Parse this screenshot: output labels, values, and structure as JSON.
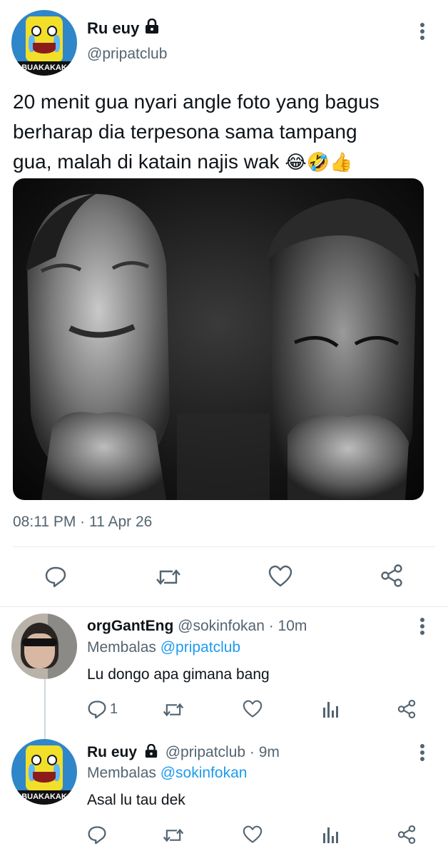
{
  "tweet": {
    "display_name": "Ru euy",
    "handle": "@pripatclub",
    "avatar_text": "BUAKAKAK",
    "text_line1": "20 menit gua nyari angle foto yang bagus",
    "text_line2": "berharap dia terpesona sama tampang",
    "text_line3": "gua, malah di katain najis wak",
    "emoji": "😂🤣👍",
    "timestamp": "08:11 PM · 11 Apr 26"
  },
  "replies": [
    {
      "display_name": "orgGantEng",
      "meta": "@sokinfokan · 10m",
      "replying_prefix": "Membalas",
      "replying_to": "@pripatclub",
      "text": "Lu dongo apa gimana bang",
      "reply_count": "1"
    },
    {
      "display_name": "Ru euy",
      "meta": "@pripatclub · 9m",
      "avatar_text": "BUAKAKAK",
      "replying_prefix": "Membalas",
      "replying_to": "@sokinfokan",
      "text": "Asal lu tau dek",
      "reply_count": ""
    }
  ],
  "colors": {
    "text": "#0f1419",
    "muted": "#536471",
    "link": "#1d9bf0",
    "divider": "#e6ecf0"
  },
  "icons": [
    "lock-icon",
    "more-icon",
    "reply-icon",
    "retweet-icon",
    "like-icon",
    "share-icon",
    "analytics-icon"
  ]
}
